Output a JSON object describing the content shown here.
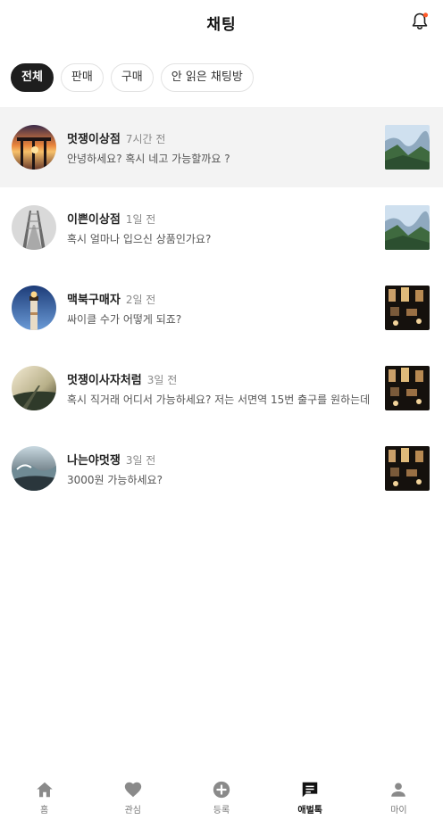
{
  "header": {
    "title": "채팅",
    "bell_icon": "bell-icon",
    "accent": "#ff5a2a"
  },
  "tabs": [
    {
      "label": "전체",
      "active": true
    },
    {
      "label": "판매",
      "active": false
    },
    {
      "label": "구매",
      "active": false
    },
    {
      "label": "안 읽은 채팅방",
      "active": false
    }
  ],
  "chats": [
    {
      "name": "멋쟁이상점",
      "time": "7시간 전",
      "message": "안녕하세요? 혹시 네고 가능할까요 ?",
      "avatar": "pier-sunset-photo",
      "thumbnail": "mountain-valley-photo",
      "highlight": true
    },
    {
      "name": "이쁜이상점",
      "time": "1일 전",
      "message": "혹시 얼마나 입으신 상품인가요?",
      "avatar": "bridge-photo",
      "thumbnail": "mountain-valley-photo",
      "highlight": false
    },
    {
      "name": "맥북구매자",
      "time": "2일 전",
      "message": "싸이클 수가 어떻게 되죠?",
      "avatar": "lighthouse-photo",
      "thumbnail": "night-cafe-photo",
      "highlight": false
    },
    {
      "name": "멋쟁이사자처럼",
      "time": "3일 전",
      "message": "혹시 직거래 어디서 가능하세요? 저는 서면역 15번 출구를 원하는데",
      "avatar": "foggy-coast-photo",
      "thumbnail": "night-cafe-photo",
      "highlight": false
    },
    {
      "name": "나는야멋쟁",
      "time": "3일 전",
      "message": "3000원 가능하세요?",
      "avatar": "wave-photo",
      "thumbnail": "night-cafe-photo",
      "highlight": false
    }
  ],
  "bottom_nav": [
    {
      "label": "홈",
      "icon": "home-icon",
      "active": false
    },
    {
      "label": "관심",
      "icon": "heart-icon",
      "active": false
    },
    {
      "label": "등록",
      "icon": "plus-circle-icon",
      "active": false
    },
    {
      "label": "애벌톡",
      "icon": "chat-icon",
      "active": true
    },
    {
      "label": "마이",
      "icon": "person-icon",
      "active": false
    }
  ]
}
